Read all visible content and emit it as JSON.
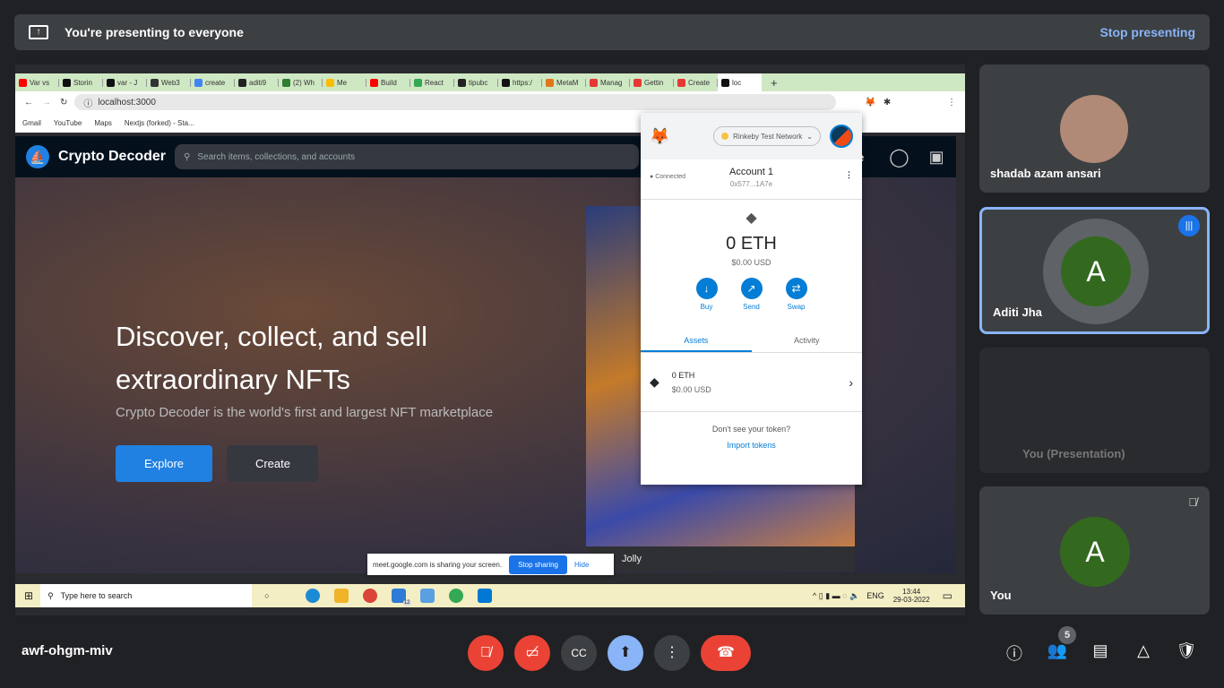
{
  "presenting_bar": {
    "message": "You're presenting to everyone",
    "stop_label": "Stop presenting"
  },
  "browser": {
    "tabs": [
      "Var vs",
      "Storin",
      "var - J",
      "Web3",
      "create",
      "aditi9",
      "(2) Wh",
      "Me",
      "Build",
      "React",
      "tipubc",
      "https:/",
      "MetaM",
      "Manag",
      "Gettin",
      "Create",
      "loc"
    ],
    "tab_colors": [
      "#ff0000",
      "#111111",
      "#111111",
      "#333333",
      "#4285f4",
      "#222222",
      "#2e7d32",
      "#fbbc04",
      "#ff0000",
      "#34a853",
      "#222222",
      "#111111",
      "#e2761b",
      "#e53935",
      "#e53935",
      "#e53935",
      "#111111"
    ],
    "new_tab": "+",
    "url": "localhost:3000",
    "bookmarks": [
      "Gmail",
      "YouTube",
      "Maps",
      "Nextjs (forked) - Sta..."
    ]
  },
  "site": {
    "brand": "Crypto Decoder",
    "search_placeholder": "Search items, collections, and accounts",
    "nav_partial": "e",
    "headline": "Discover, collect, and sell extraordinary NFTs",
    "subtitle": "Crypto Decoder is the world's first and largest NFT marketplace",
    "explore_label": "Explore",
    "create_label": "Create",
    "nft_name": "Jolly"
  },
  "metamask": {
    "network": "Rinkeby Test Network",
    "status": "Connected",
    "account": "Account 1",
    "address": "0x577...1A7e",
    "balance": "0 ETH",
    "balance_usd": "$0.00 USD",
    "actions": [
      "Buy",
      "Send",
      "Swap"
    ],
    "tabs": [
      "Assets",
      "Activity"
    ],
    "asset": {
      "amount": "0 ETH",
      "usd": "$0.00 USD"
    },
    "no_token": "Don't see your token?",
    "import": "Import tokens"
  },
  "share_banner": {
    "text": "meet.google.com is sharing your screen.",
    "stop": "Stop sharing",
    "hide": "Hide"
  },
  "taskbar": {
    "search_placeholder": "Type here to search",
    "mail_badge": "12",
    "lang": "ENG",
    "time": "13:44",
    "date": "29-03-2022"
  },
  "participants": [
    {
      "name": "shadab azam ansari"
    },
    {
      "name": "Aditi Jha",
      "initial": "A",
      "speaking": true
    },
    {
      "name": "You (Presentation)"
    },
    {
      "name": "You",
      "initial": "A",
      "muted": true
    }
  ],
  "meeting": {
    "code": "awf-ohgm-miv",
    "participant_count": "5"
  },
  "colors": {
    "accent": "#8ab4f8",
    "danger": "#ea4335",
    "present": "#8ab4f8",
    "avatar": "#33691e"
  }
}
